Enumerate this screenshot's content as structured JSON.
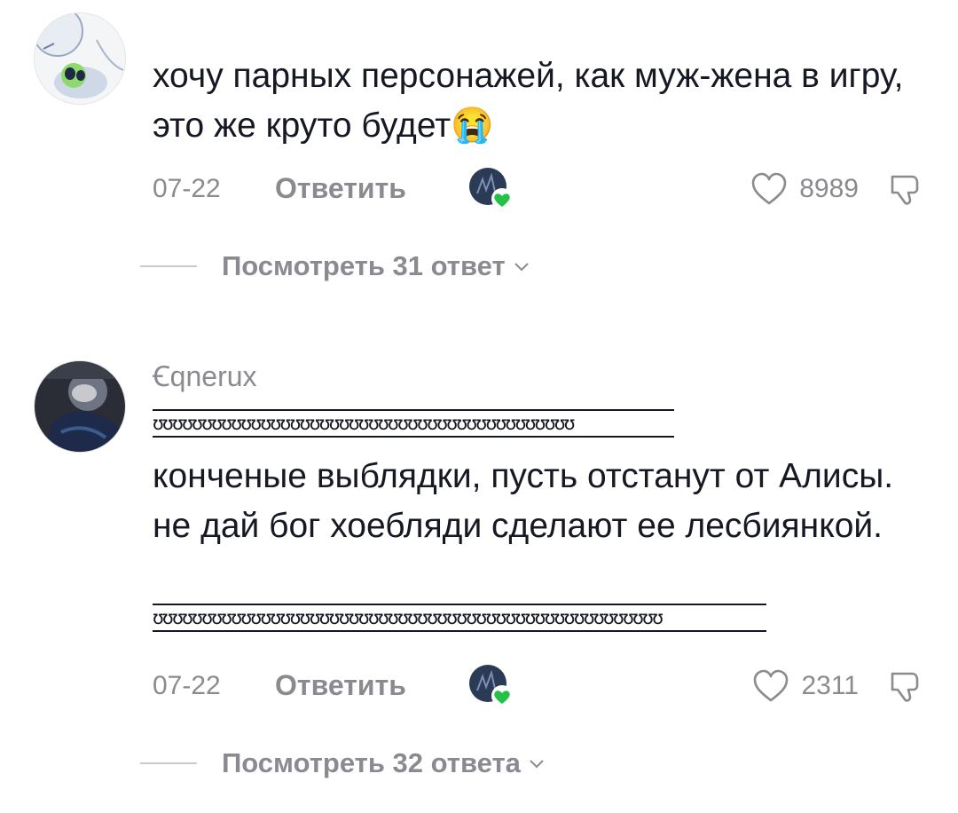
{
  "colors": {
    "accent_green": "#25c046",
    "muted": "#8a8b91",
    "text": "#161823"
  },
  "comments": [
    {
      "text": "хочу парных персонажей, как муж-жена в игру, это же круто будет😭",
      "date": "07-22",
      "reply_label": "Ответить",
      "likes": "8989",
      "view_replies": "Посмотреть 31 ответ"
    },
    {
      "username": "Ꞓqnerux",
      "deco_line1": "ʊʊʊʊʊʊʊʊʊʊʊʊʊʊʊʊʊʊʊʊʊʊʊʊʊʊʊʊʊʊʊʊʊʊʊʊʊʊʊʊʊʊʊ",
      "text": "конченые выблядки, пусть отстанут от Алисы. не дай бог хоебляди сделают ее лесбиянкой.",
      "deco_line2": "ʊʊʊʊʊʊʊʊʊʊʊʊʊʊʊʊʊʊʊʊʊʊʊʊʊʊʊʊʊʊʊʊʊʊʊʊʊʊʊʊʊʊʊʊʊʊʊʊʊʊʊʊ",
      "date": "07-22",
      "reply_label": "Ответить",
      "likes": "2311",
      "view_replies": "Посмотреть 32 ответа"
    }
  ],
  "icons": {
    "heart": "heart-outline-icon",
    "dislike": "thumbs-down-icon",
    "chevron": "chevron-down-icon",
    "creator_badge": "green-heart-icon"
  }
}
